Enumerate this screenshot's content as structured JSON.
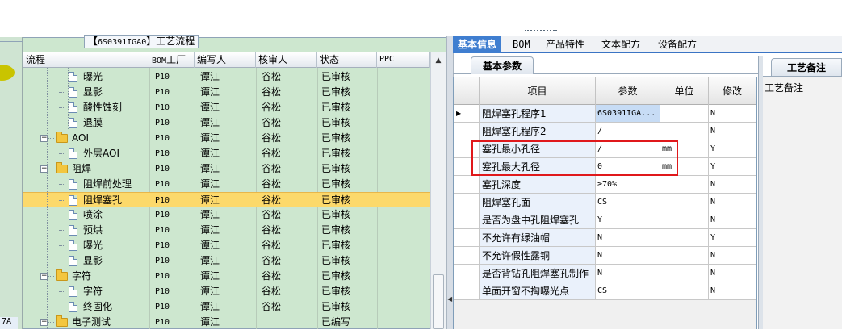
{
  "left_panel": {
    "bottom_text": "7A"
  },
  "tree_panel": {
    "caption_prefix": "【",
    "caption_code": "6S0391IGA0",
    "caption_suffix": "】工艺流程",
    "columns": [
      "流程",
      "BOM工厂",
      "编写人",
      "核审人",
      "状态",
      "PPC"
    ],
    "rows": [
      {
        "name": "曝光",
        "factory": "P10",
        "writer": "谭江",
        "reviewer": "谷松",
        "status": "已审核",
        "kind": "file",
        "level": 2,
        "selected": false
      },
      {
        "name": "显影",
        "factory": "P10",
        "writer": "谭江",
        "reviewer": "谷松",
        "status": "已审核",
        "kind": "file",
        "level": 2,
        "selected": false
      },
      {
        "name": "酸性蚀刻",
        "factory": "P10",
        "writer": "谭江",
        "reviewer": "谷松",
        "status": "已审核",
        "kind": "file",
        "level": 2,
        "selected": false
      },
      {
        "name": "退膜",
        "factory": "P10",
        "writer": "谭江",
        "reviewer": "谷松",
        "status": "已审核",
        "kind": "file",
        "level": 2,
        "selected": false
      },
      {
        "name": "AOI",
        "factory": "P10",
        "writer": "谭江",
        "reviewer": "谷松",
        "status": "已审核",
        "kind": "folder",
        "level": 1,
        "selected": false
      },
      {
        "name": "外层AOI",
        "factory": "P10",
        "writer": "谭江",
        "reviewer": "谷松",
        "status": "已审核",
        "kind": "file",
        "level": 2,
        "selected": false
      },
      {
        "name": "阻焊",
        "factory": "P10",
        "writer": "谭江",
        "reviewer": "谷松",
        "status": "已审核",
        "kind": "folder",
        "level": 1,
        "selected": false
      },
      {
        "name": "阻焊前处理",
        "factory": "P10",
        "writer": "谭江",
        "reviewer": "谷松",
        "status": "已审核",
        "kind": "file",
        "level": 2,
        "selected": false
      },
      {
        "name": "阻焊塞孔",
        "factory": "P10",
        "writer": "谭江",
        "reviewer": "谷松",
        "status": "已审核",
        "kind": "file",
        "level": 2,
        "selected": true
      },
      {
        "name": "喷涂",
        "factory": "P10",
        "writer": "谭江",
        "reviewer": "谷松",
        "status": "已审核",
        "kind": "file",
        "level": 2,
        "selected": false
      },
      {
        "name": "预烘",
        "factory": "P10",
        "writer": "谭江",
        "reviewer": "谷松",
        "status": "已审核",
        "kind": "file",
        "level": 2,
        "selected": false
      },
      {
        "name": "曝光",
        "factory": "P10",
        "writer": "谭江",
        "reviewer": "谷松",
        "status": "已审核",
        "kind": "file",
        "level": 2,
        "selected": false
      },
      {
        "name": "显影",
        "factory": "P10",
        "writer": "谭江",
        "reviewer": "谷松",
        "status": "已审核",
        "kind": "file",
        "level": 2,
        "selected": false
      },
      {
        "name": "字符",
        "factory": "P10",
        "writer": "谭江",
        "reviewer": "谷松",
        "status": "已审核",
        "kind": "folder",
        "level": 1,
        "selected": false
      },
      {
        "name": "字符",
        "factory": "P10",
        "writer": "谭江",
        "reviewer": "谷松",
        "status": "已审核",
        "kind": "file",
        "level": 2,
        "selected": false
      },
      {
        "name": "终固化",
        "factory": "P10",
        "writer": "谭江",
        "reviewer": "谷松",
        "status": "已审核",
        "kind": "file",
        "level": 2,
        "selected": false
      },
      {
        "name": "电子测试",
        "factory": "P10",
        "writer": "谭江",
        "reviewer": "",
        "status": "已编写",
        "kind": "folder",
        "level": 1,
        "selected": false
      }
    ]
  },
  "right_panel": {
    "tabs": [
      "基本信息",
      "BOM",
      "产品特性",
      "文本配方",
      "设备配方"
    ],
    "active_tab": "基本信息",
    "subtab": "基本参数",
    "grid_columns": [
      "项目",
      "参数",
      "单位",
      "修改"
    ],
    "grid_rows": [
      {
        "item": "阻焊塞孔程序1",
        "param": "6S0391IGA...",
        "unit": "",
        "modify": "N",
        "current": true
      },
      {
        "item": "阻焊塞孔程序2",
        "param": "/",
        "unit": "",
        "modify": "N",
        "current": false
      },
      {
        "item": "塞孔最小孔径",
        "param": "/",
        "unit": "mm",
        "modify": "Y",
        "current": false
      },
      {
        "item": "塞孔最大孔径",
        "param": "0",
        "unit": "mm",
        "modify": "Y",
        "current": false
      },
      {
        "item": "塞孔深度",
        "param": "≥70%",
        "unit": "",
        "modify": "N",
        "current": false
      },
      {
        "item": "阻焊塞孔面",
        "param": "CS",
        "unit": "",
        "modify": "N",
        "current": false
      },
      {
        "item": "是否为盘中孔阻焊塞孔",
        "param": "Y",
        "unit": "",
        "modify": "N",
        "current": false
      },
      {
        "item": "不允许有绿油帽",
        "param": "N",
        "unit": "",
        "modify": "Y",
        "current": false
      },
      {
        "item": "不允许假性露铜",
        "param": "N",
        "unit": "",
        "modify": "N",
        "current": false
      },
      {
        "item": "是否背钻孔阻焊塞孔制作",
        "param": "N",
        "unit": "",
        "modify": "N",
        "current": false
      },
      {
        "item": "单面开窗不掏曝光点",
        "param": "CS",
        "unit": "",
        "modify": "N",
        "current": false
      }
    ],
    "remarks_tab": "工艺备注",
    "remarks_label": "工艺备注"
  },
  "colors": {
    "tree_bg": "#cde7cf",
    "selected_row": "#fcd96b",
    "tab_active": "#3f7ed0",
    "highlight_box": "#e0181b"
  }
}
